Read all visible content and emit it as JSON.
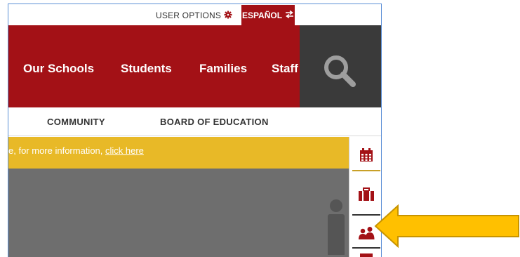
{
  "utility": {
    "user_options_label": "USER OPTIONS",
    "espanol_label": "ESPAÑOL"
  },
  "main_nav": {
    "items": [
      {
        "label": "Our Schools"
      },
      {
        "label": "Students"
      },
      {
        "label": "Families"
      },
      {
        "label": "Staff"
      }
    ]
  },
  "sub_nav": {
    "items": [
      {
        "label": "COMMUNITY"
      },
      {
        "label": "BOARD OF EDUCATION"
      }
    ]
  },
  "alert": {
    "text": "e, for more information, ",
    "link_label": "click here"
  },
  "side_toolbar": {
    "icons": [
      "calendar-icon",
      "briefcase-icon",
      "people-icon",
      "toolbar-icon"
    ]
  },
  "colors": {
    "brand_red": "#a31116",
    "search_dark": "#3a3a3a",
    "alert_gold": "#e8b927",
    "hero_gray": "#6e6e6e",
    "annotation_arrow": "#ffc000"
  }
}
